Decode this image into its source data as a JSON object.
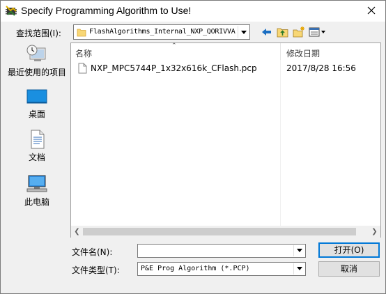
{
  "window": {
    "title": "Specify Programming Algorithm to Use!",
    "app_icon": "pe-micro-icon",
    "close_icon": "close-icon"
  },
  "lookin": {
    "label": "查找范围(I):",
    "value": "FlashAlgorithms_Internal_NXP_QORIVVA"
  },
  "toolbar": {
    "icons": [
      "back-icon",
      "up-folder-icon",
      "new-folder-icon",
      "view-menu-icon"
    ]
  },
  "places": [
    {
      "label": "最近使用的项目",
      "icon": "recent-items-icon"
    },
    {
      "label": "桌面",
      "icon": "desktop-icon"
    },
    {
      "label": "文档",
      "icon": "documents-icon"
    },
    {
      "label": "此电脑",
      "icon": "this-pc-icon"
    }
  ],
  "filelist": {
    "columns": {
      "name": "名称",
      "date": "修改日期"
    },
    "files": [
      {
        "name": "NXP_MPC5744P_1x32x616k_CFlash.pcp",
        "date": "2017/8/28 16:56",
        "icon": "file-icon"
      }
    ]
  },
  "filename": {
    "label": "文件名(N):",
    "value": ""
  },
  "filetype": {
    "label": "文件类型(T):",
    "value": "P&E Prog Algorithm (*.PCP)"
  },
  "buttons": {
    "open": "打开(O)",
    "cancel": "取消"
  },
  "colors": {
    "accent": "#0078d7",
    "window_bg": "#f0f0f0",
    "folder": "#f8d775"
  }
}
